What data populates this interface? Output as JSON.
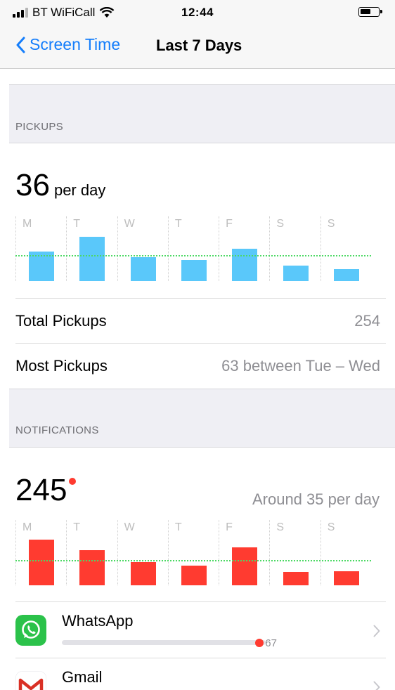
{
  "status_bar": {
    "carrier": "BT WiFiCall",
    "time": "12:44"
  },
  "nav": {
    "back_label": "Screen Time",
    "title": "Last 7 Days"
  },
  "pickups": {
    "section_header": "PICKUPS",
    "value": "36",
    "unit": "per day",
    "chart_data": {
      "type": "bar",
      "categories": [
        "M",
        "T",
        "W",
        "T",
        "F",
        "S",
        "S"
      ],
      "values": [
        43,
        65,
        35,
        31,
        48,
        23,
        18
      ],
      "average": 36,
      "ymax": 95,
      "color": "#5ac8fa"
    },
    "rows": [
      {
        "label": "Total Pickups",
        "value": "254"
      },
      {
        "label": "Most Pickups",
        "value": "63 between Tue – Wed"
      }
    ]
  },
  "notifications": {
    "section_header": "NOTIFICATIONS",
    "value": "245",
    "subtitle": "Around 35 per day",
    "chart_data": {
      "type": "bar",
      "categories": [
        "M",
        "T",
        "W",
        "T",
        "F",
        "S",
        "S"
      ],
      "values": [
        66,
        51,
        34,
        29,
        55,
        19,
        20
      ],
      "average": 35,
      "ymax": 95,
      "color": "#ff3b30"
    },
    "apps": [
      {
        "name": "WhatsApp",
        "count": "67",
        "fraction": 0.97,
        "icon": "whatsapp-icon"
      },
      {
        "name": "Gmail",
        "icon": "gmail-icon"
      }
    ]
  },
  "colors": {
    "accent": "#157efb",
    "pickups_bar": "#5ac8fa",
    "notifications_bar": "#ff3b30",
    "average_line": "#4cd964"
  }
}
